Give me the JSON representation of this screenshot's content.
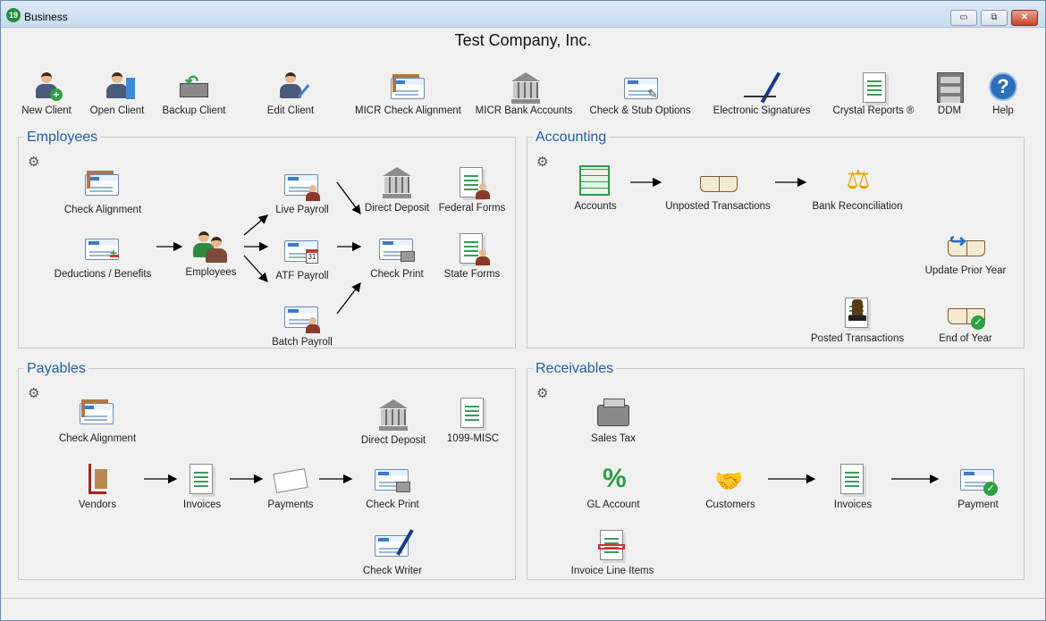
{
  "window": {
    "badge": "19",
    "title": "Business",
    "controls": {
      "minimize": "▭",
      "restore": "⧉",
      "close": "✕"
    }
  },
  "company": "Test Company, Inc.",
  "toolbar": {
    "new_client": "New Client",
    "open_client": "Open Client",
    "backup_client": "Backup Client",
    "edit_client": "Edit Client",
    "micr_check_alignment": "MICR Check Alignment",
    "micr_bank_accounts": "MICR Bank Accounts",
    "check_stub_options": "Check & Stub Options",
    "electronic_signatures": "Electronic Signatures",
    "crystal_reports": "Crystal Reports ®",
    "ddm": "DDM",
    "help": "Help",
    "help_glyph": "?"
  },
  "employees": {
    "title": "Employees",
    "gear": "⚙",
    "check_alignment": "Check Alignment",
    "deductions_benefits": "Deductions / Benefits",
    "employees": "Employees",
    "live_payroll": "Live Payroll",
    "atf_payroll": "ATF Payroll",
    "atf_cal": "31",
    "batch_payroll": "Batch Payroll",
    "direct_deposit": "Direct Deposit",
    "check_print": "Check Print",
    "federal_forms": "Federal Forms",
    "state_forms": "State Forms"
  },
  "accounting": {
    "title": "Accounting",
    "gear": "⚙",
    "accounts": "Accounts",
    "unposted_transactions": "Unposted Transactions",
    "bank_reconciliation": "Bank Reconciliation",
    "update_prior_year": "Update Prior Year",
    "posted_transactions": "Posted Transactions",
    "end_of_year": "End of Year",
    "scale_glyph": "⚖",
    "tick_glyph": "✓"
  },
  "payables": {
    "title": "Payables",
    "gear": "⚙",
    "check_alignment": "Check Alignment",
    "direct_deposit": "Direct Deposit",
    "misc_1099": "1099-MISC",
    "vendors": "Vendors",
    "invoices": "Invoices",
    "payments": "Payments",
    "check_print": "Check Print",
    "check_writer": "Check Writer"
  },
  "receivables": {
    "title": "Receivables",
    "gear": "⚙",
    "sales_tax": "Sales Tax",
    "gl_account": "GL Account",
    "gl_glyph": "%",
    "customers": "Customers",
    "customers_glyph": "🤝",
    "invoices": "Invoices",
    "payment": "Payment",
    "invoice_line_items": "Invoice Line Items",
    "tick_glyph": "✓"
  },
  "colors": {
    "panel_title": "#1f5fa8",
    "window_border": "#6d8bb3",
    "background": "#f0f0f0"
  }
}
